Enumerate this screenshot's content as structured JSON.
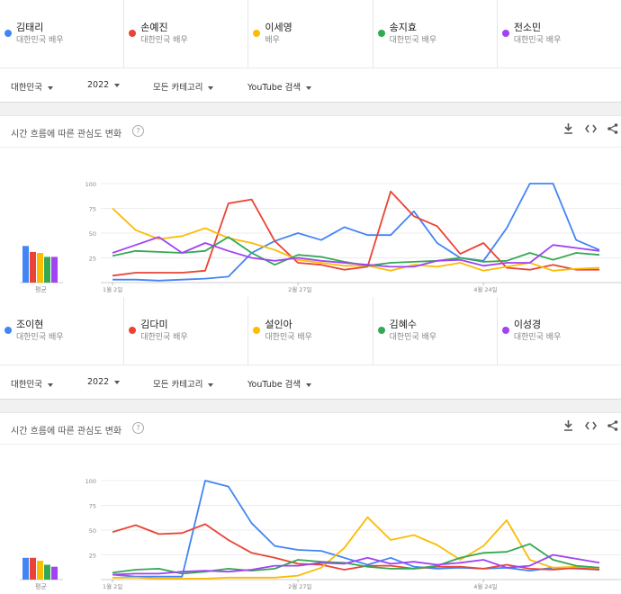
{
  "colors": {
    "blue": "#4285f4",
    "red": "#ea4335",
    "yellow": "#fbbc04",
    "green": "#34a853",
    "purple": "#a142f4"
  },
  "panels": [
    {
      "terms": [
        {
          "name": "김태리",
          "sub": "대한민국 배우",
          "color": "#4285f4"
        },
        {
          "name": "손예진",
          "sub": "대한민국 배우",
          "color": "#ea4335"
        },
        {
          "name": "이세영",
          "sub": "배우",
          "color": "#fbbc04"
        },
        {
          "name": "송지효",
          "sub": "대한민국 배우",
          "color": "#34a853"
        },
        {
          "name": "전소민",
          "sub": "대한민국 배우",
          "color": "#a142f4"
        }
      ],
      "filters": {
        "region": "대한민국",
        "year": "2022",
        "category": "모든 카테고리",
        "source": "YouTube 검색"
      },
      "section_title": "시간 흐름에 따른 관심도 변화",
      "icons": [
        "help-icon",
        "download-icon",
        "embed-icon",
        "share-icon"
      ],
      "avg_label": "평균",
      "chart_data": {
        "type": "line",
        "x": [
          "1월 2일",
          "1월 9일",
          "1월 16일",
          "1월 23일",
          "1월 30일",
          "2월 6일",
          "2월 13일",
          "2월 20일",
          "2월 27일",
          "3월 6일",
          "3월 13일",
          "3월 20일",
          "3월 27일",
          "4월 3일",
          "4월 10일",
          "4월 17일",
          "4월 24일",
          "5월 1일",
          "5월 8일",
          "5월 15일",
          "5월 22일",
          "5월 29일"
        ],
        "x_tick_labels": [
          "1월 2일",
          "2월 27일",
          "4월 24일"
        ],
        "y_ticks": [
          25,
          50,
          75,
          100
        ],
        "ylim": [
          0,
          100
        ],
        "series": [
          {
            "name": "김태리",
            "color": "#4285f4",
            "values": [
              3,
              3,
              2,
              3,
              4,
              6,
              30,
              42,
              50,
              43,
              56,
              48,
              48,
              72,
              40,
              25,
              22,
              55,
              100,
              100,
              43,
              33
            ]
          },
          {
            "name": "손예진",
            "color": "#ea4335",
            "values": [
              7,
              10,
              10,
              10,
              12,
              80,
              84,
              42,
              20,
              18,
              13,
              16,
              92,
              67,
              57,
              29,
              40,
              15,
              13,
              18,
              13,
              13
            ]
          },
          {
            "name": "이세영",
            "color": "#fbbc04",
            "values": [
              75,
              53,
              44,
              47,
              55,
              45,
              40,
              33,
              23,
              20,
              17,
              17,
              12,
              18,
              16,
              20,
              12,
              16,
              20,
              12,
              14,
              15
            ]
          },
          {
            "name": "송지효",
            "color": "#34a853",
            "values": [
              27,
              32,
              31,
              30,
              32,
              46,
              30,
              18,
              28,
              26,
              21,
              17,
              20,
              21,
              22,
              25,
              21,
              22,
              30,
              23,
              30,
              28
            ]
          },
          {
            "name": "전소민",
            "color": "#a142f4",
            "values": [
              30,
              38,
              46,
              30,
              40,
              32,
              25,
              22,
              25,
              22,
              20,
              18,
              16,
              16,
              22,
              23,
              17,
              20,
              20,
              38,
              35,
              32
            ]
          }
        ],
        "averages": [
          37,
          31,
          30,
          26,
          26
        ]
      }
    },
    {
      "terms": [
        {
          "name": "조이현",
          "sub": "대한민국 배우",
          "color": "#4285f4"
        },
        {
          "name": "김다미",
          "sub": "대한민국 배우",
          "color": "#ea4335"
        },
        {
          "name": "설인아",
          "sub": "대한민국 배우",
          "color": "#fbbc04"
        },
        {
          "name": "김혜수",
          "sub": "대한민국 배우",
          "color": "#34a853"
        },
        {
          "name": "이성경",
          "sub": "대한민국 배우",
          "color": "#a142f4"
        }
      ],
      "filters": {
        "region": "대한민국",
        "year": "2022",
        "category": "모든 카테고리",
        "source": "YouTube 검색"
      },
      "section_title": "시간 흐름에 따른 관심도 변화",
      "icons": [
        "help-icon",
        "download-icon",
        "embed-icon",
        "share-icon"
      ],
      "avg_label": "평균",
      "chart_data": {
        "type": "line",
        "x": [
          "1월 2일",
          "1월 9일",
          "1월 16일",
          "1월 23일",
          "1월 30일",
          "2월 6일",
          "2월 13일",
          "2월 20일",
          "2월 27일",
          "3월 6일",
          "3월 13일",
          "3월 20일",
          "3월 27일",
          "4월 3일",
          "4월 10일",
          "4월 17일",
          "4월 24일",
          "5월 1일",
          "5월 8일",
          "5월 15일",
          "5월 22일",
          "5월 29일"
        ],
        "x_tick_labels": [
          "1월 2일",
          "2월 27일",
          "4월 24일"
        ],
        "y_ticks": [
          25,
          50,
          75,
          100
        ],
        "ylim": [
          0,
          100
        ],
        "series": [
          {
            "name": "조이현",
            "color": "#4285f4",
            "values": [
              5,
              3,
              3,
              3,
              100,
              94,
              57,
              34,
              30,
              29,
              22,
              15,
              22,
              13,
              11,
              12,
              11,
              12,
              9,
              12,
              11,
              10
            ]
          },
          {
            "name": "김다미",
            "color": "#ea4335",
            "values": [
              48,
              55,
              46,
              47,
              56,
              40,
              27,
              22,
              16,
              15,
              10,
              14,
              14,
              11,
              13,
              13,
              11,
              15,
              11,
              10,
              12,
              10
            ]
          },
          {
            "name": "설인아",
            "color": "#fbbc04",
            "values": [
              2,
              2,
              1,
              1,
              1,
              2,
              2,
              2,
              4,
              12,
              32,
              63,
              40,
              45,
              35,
              20,
              34,
              60,
              20,
              12,
              13,
              12
            ]
          },
          {
            "name": "김혜수",
            "color": "#34a853",
            "values": [
              7,
              10,
              11,
              6,
              8,
              11,
              9,
              11,
              20,
              18,
              17,
              13,
              11,
              11,
              14,
              22,
              27,
              28,
              36,
              20,
              14,
              12
            ]
          },
          {
            "name": "이성경",
            "color": "#a142f4",
            "values": [
              5,
              6,
              6,
              8,
              9,
              8,
              10,
              14,
              14,
              17,
              16,
              22,
              16,
              18,
              15,
              17,
              20,
              12,
              14,
              25,
              21,
              17
            ]
          }
        ],
        "averages": [
          22,
          22,
          19,
          15,
          13
        ]
      }
    }
  ]
}
